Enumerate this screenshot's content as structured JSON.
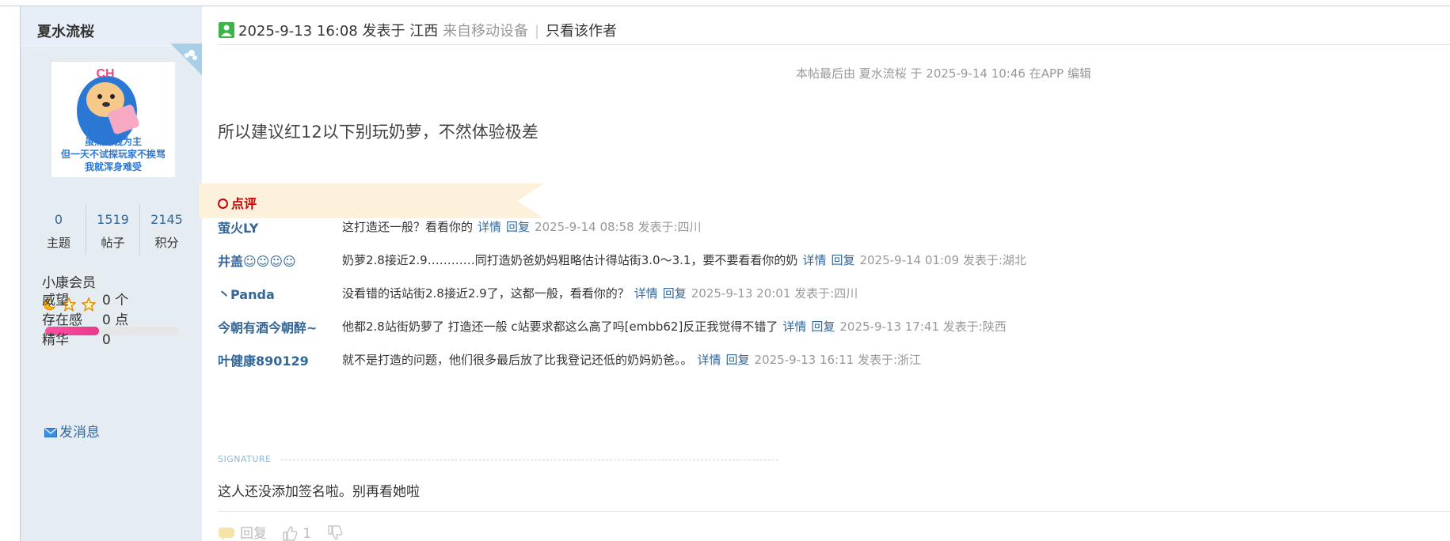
{
  "user": {
    "name": "夏水流桜",
    "stats": [
      {
        "value": "0",
        "label": "主题"
      },
      {
        "value": "1519",
        "label": "帖子"
      },
      {
        "value": "2145",
        "label": "积分"
      }
    ],
    "group": "小康会员",
    "level_progress_percent": 40,
    "info": [
      {
        "label": "威望",
        "value": "0 个"
      },
      {
        "label": "存在感",
        "value": "0 点"
      },
      {
        "label": "精华",
        "value": "0"
      }
    ],
    "send_message": "发消息",
    "avatar_caption_lines": [
      "虽然赚钱为主",
      "但一天不试探玩家不挨骂",
      "我就浑身难受"
    ]
  },
  "post": {
    "datetime": "2025-9-13 16:08",
    "posted_in": "发表于 江西",
    "device": "来自移动设备",
    "separator": "|",
    "only_author": "只看该作者",
    "edit_note": "本帖最后由 夏水流桜 于 2025-9-14 10:46 在APP 编辑",
    "message": "所以建议红12以下别玩奶萝，不然体验极差"
  },
  "ratings": {
    "title": "点评",
    "items": [
      {
        "author": "萤火LY",
        "text": "这打造还一般？看看你的",
        "detail": "详情",
        "reply": "回复",
        "time": "2025-9-14 08:58 发表于:四川"
      },
      {
        "author": "井盖☺☺☺☺",
        "text": "奶萝2.8接近2.9…………同打造奶爸奶妈粗略估计得站街3.0～3.1，要不要看看你的奶",
        "detail": "详情",
        "reply": "回复",
        "time": "2025-9-14 01:09 发表于:湖北"
      },
      {
        "author": "丶Panda",
        "text": "没看错的话站街2.8接近2.9了，这都一般，看看你的？",
        "detail": "详情",
        "reply": "回复",
        "time": "2025-9-13 20:01 发表于:四川"
      },
      {
        "author": "今朝有酒今朝醉~",
        "text": "他都2.8站街奶萝了 打造还一般 c站要求都这么高了吗[embb62]反正我觉得不错了",
        "detail": "详情",
        "reply": "回复",
        "time": "2025-9-13 17:41 发表于:陕西"
      },
      {
        "author": "叶健康890129",
        "text": "就不是打造的问题，他们很多最后放了比我登记还低的奶妈奶爸。。",
        "detail": "详情",
        "reply": "回复",
        "time": "2025-9-13 16:11 发表于:浙江"
      }
    ]
  },
  "signature": {
    "title": "SIGNATURE",
    "text": "这人还没添加签名啦。别再看她啦"
  },
  "actions": {
    "reply": "回复",
    "like_count": "1"
  },
  "colors": {
    "sidebar_bg": "#e5edf2",
    "link_blue": "#336699",
    "rate_red": "#cc0000",
    "level_pink": "#ff4fa3"
  }
}
